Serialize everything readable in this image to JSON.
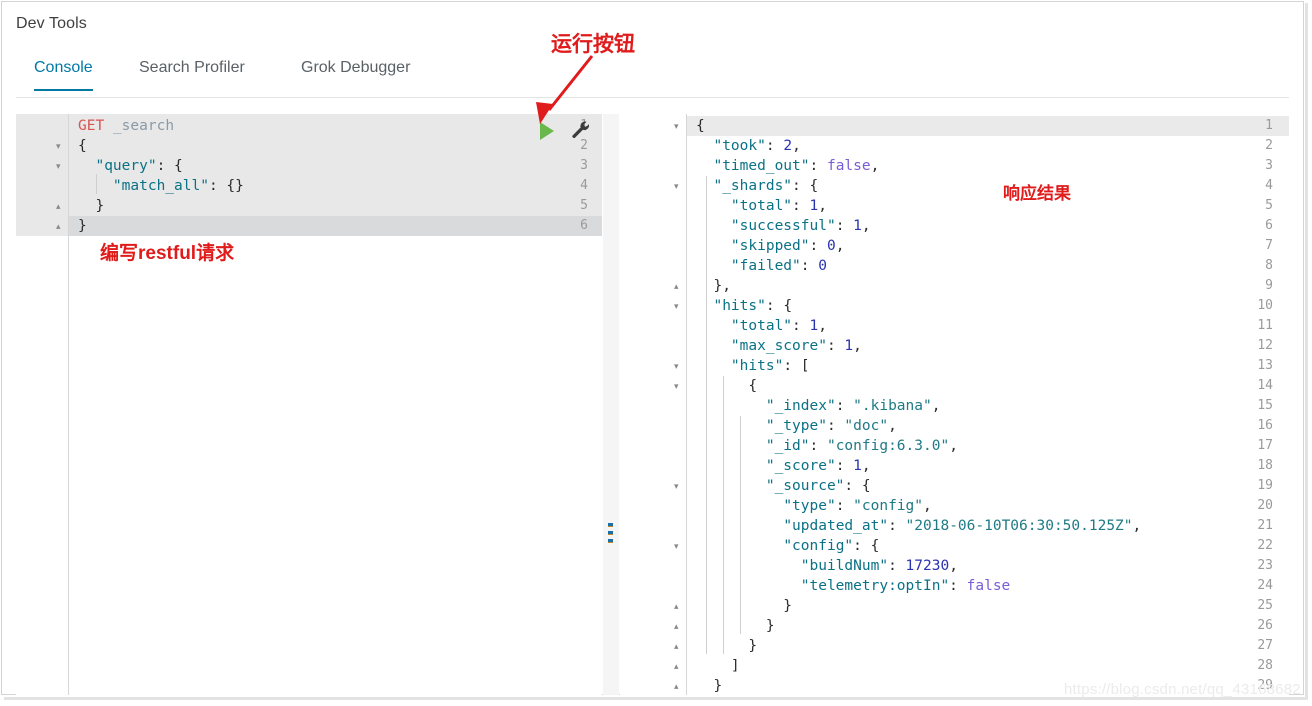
{
  "window": {
    "app_title": "Dev Tools"
  },
  "tabs": [
    {
      "label": "Console",
      "active": true
    },
    {
      "label": "Search Profiler",
      "active": false
    },
    {
      "label": "Grok Debugger",
      "active": false
    }
  ],
  "toolbar": {
    "play_icon": "play-icon",
    "wrench_icon": "wrench-icon"
  },
  "editor": {
    "lines": [
      {
        "no": "1",
        "fold": "",
        "text": "GET _search"
      },
      {
        "no": "2",
        "fold": "▾",
        "text": "{"
      },
      {
        "no": "3",
        "fold": "▾",
        "text": "  \"query\": {"
      },
      {
        "no": "4",
        "fold": "",
        "text": "    \"match_all\": {}"
      },
      {
        "no": "5",
        "fold": "▴",
        "text": "  }"
      },
      {
        "no": "6",
        "fold": "▴",
        "text": "}"
      }
    ],
    "request_method": "GET",
    "request_path": "_search",
    "highlighted_line": "6"
  },
  "output": {
    "lines": [
      {
        "no": "1",
        "fold": "▾",
        "text": "{"
      },
      {
        "no": "2",
        "fold": "",
        "text": "  \"took\": 2,"
      },
      {
        "no": "3",
        "fold": "",
        "text": "  \"timed_out\": false,"
      },
      {
        "no": "4",
        "fold": "▾",
        "text": "  \"_shards\": {"
      },
      {
        "no": "5",
        "fold": "",
        "text": "    \"total\": 1,"
      },
      {
        "no": "6",
        "fold": "",
        "text": "    \"successful\": 1,"
      },
      {
        "no": "7",
        "fold": "",
        "text": "    \"skipped\": 0,"
      },
      {
        "no": "8",
        "fold": "",
        "text": "    \"failed\": 0"
      },
      {
        "no": "9",
        "fold": "▴",
        "text": "  },"
      },
      {
        "no": "10",
        "fold": "▾",
        "text": "  \"hits\": {"
      },
      {
        "no": "11",
        "fold": "",
        "text": "    \"total\": 1,"
      },
      {
        "no": "12",
        "fold": "",
        "text": "    \"max_score\": 1,"
      },
      {
        "no": "13",
        "fold": "▾",
        "text": "    \"hits\": ["
      },
      {
        "no": "14",
        "fold": "▾",
        "text": "      {"
      },
      {
        "no": "15",
        "fold": "",
        "text": "        \"_index\": \".kibana\","
      },
      {
        "no": "16",
        "fold": "",
        "text": "        \"_type\": \"doc\","
      },
      {
        "no": "17",
        "fold": "",
        "text": "        \"_id\": \"config:6.3.0\","
      },
      {
        "no": "18",
        "fold": "",
        "text": "        \"_score\": 1,"
      },
      {
        "no": "19",
        "fold": "▾",
        "text": "        \"_source\": {"
      },
      {
        "no": "20",
        "fold": "",
        "text": "          \"type\": \"config\","
      },
      {
        "no": "21",
        "fold": "",
        "text": "          \"updated_at\": \"2018-06-10T06:30:50.125Z\","
      },
      {
        "no": "22",
        "fold": "▾",
        "text": "          \"config\": {"
      },
      {
        "no": "23",
        "fold": "",
        "text": "            \"buildNum\": 17230,"
      },
      {
        "no": "24",
        "fold": "",
        "text": "            \"telemetry:optIn\": false"
      },
      {
        "no": "25",
        "fold": "▴",
        "text": "          }"
      },
      {
        "no": "26",
        "fold": "▴",
        "text": "        }"
      },
      {
        "no": "27",
        "fold": "▴",
        "text": "      }"
      },
      {
        "no": "28",
        "fold": "▴",
        "text": "    ]"
      },
      {
        "no": "29",
        "fold": "▴",
        "text": "  }"
      }
    ],
    "highlighted_line": "1",
    "response_values": {
      "took": 2,
      "timed_out": false,
      "_shards": {
        "total": 1,
        "successful": 1,
        "skipped": 0,
        "failed": 0
      },
      "hits": {
        "total": 1,
        "max_score": 1,
        "hits": [
          {
            "_index": ".kibana",
            "_type": "doc",
            "_id": "config:6.3.0",
            "_score": 1,
            "_source": {
              "type": "config",
              "updated_at": "2018-06-10T06:30:50.125Z",
              "config": {
                "buildNum": 17230,
                "telemetry:optIn": false
              }
            }
          }
        ]
      }
    }
  },
  "annotations": {
    "run_button": "运行按钮",
    "response_result": "响应结果",
    "write_request_cn1": "编写",
    "write_request_latin": "restful",
    "write_request_cn2": "请求",
    "color": "#e01b1b"
  },
  "watermark": "https://blog.csdn.net/qq_43168682",
  "colors": {
    "accent": "#0079a5",
    "play_green": "#69b84b",
    "annotation_red": "#e01b1b",
    "editor_bg": "#e8e8e8",
    "highlight_row": "#d9dadb"
  }
}
